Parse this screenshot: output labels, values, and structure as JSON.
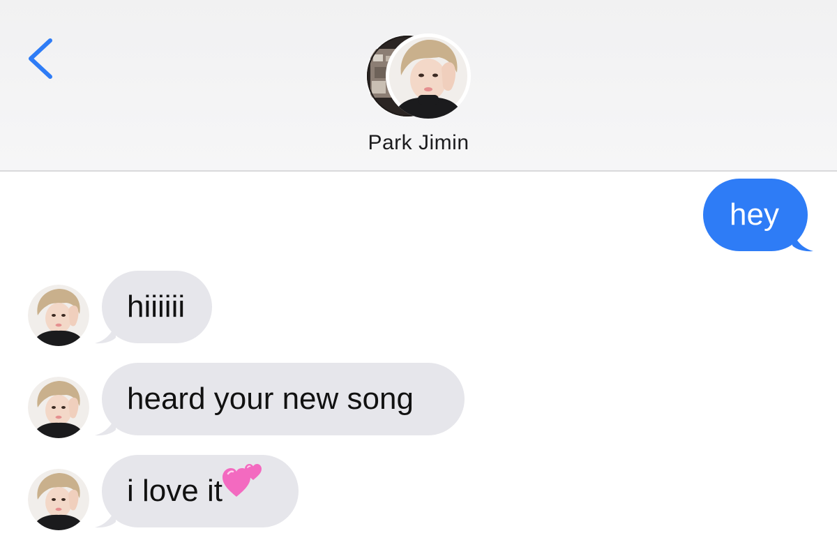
{
  "header": {
    "contact_name": "Park Jimin"
  },
  "icons": {
    "back": "chevron-left-icon",
    "hearts": "two-hearts-emoji"
  },
  "colors": {
    "accent": "#2e7cf6",
    "received_bubble": "#e6e6eb",
    "back_chevron": "#2e7cf6"
  },
  "messages": [
    {
      "direction": "sent",
      "text": "hey"
    },
    {
      "direction": "received",
      "text": "hiiiiii"
    },
    {
      "direction": "received",
      "text": "heard your new song"
    },
    {
      "direction": "received",
      "text": "i love it"
    }
  ]
}
